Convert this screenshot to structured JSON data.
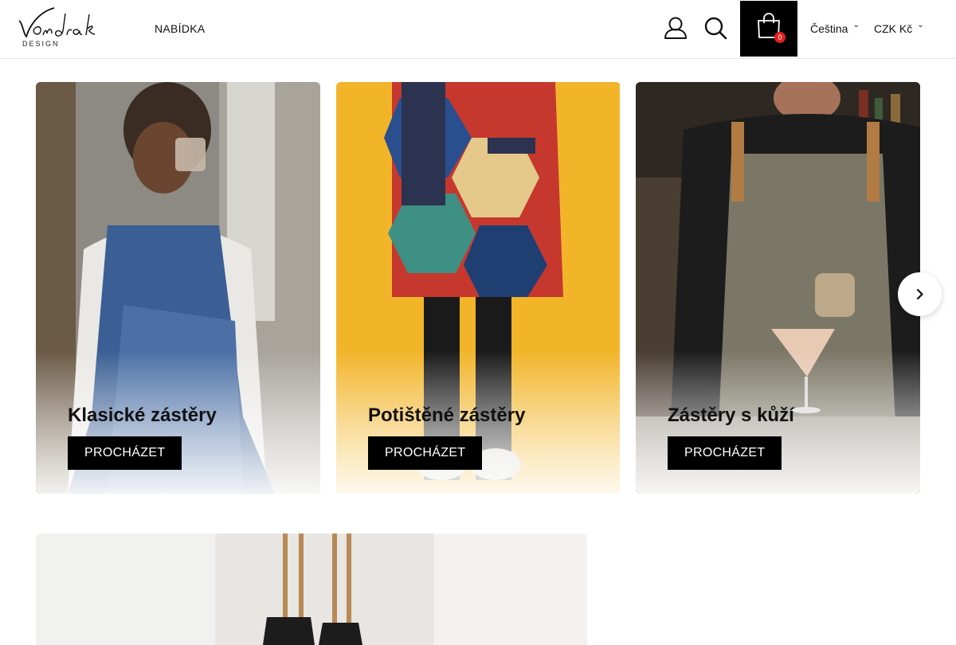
{
  "header": {
    "logo_text": "Vondrak",
    "logo_sub": "DESIGN",
    "nav_menu": "NABÍDKA",
    "cart_count": "0",
    "language": "Čeština",
    "currency": "CZK Kč"
  },
  "categories": [
    {
      "title": "Klasické zástěry",
      "button": "PROCHÁZET"
    },
    {
      "title": "Potištěné zástěry",
      "button": "PROCHÁZET"
    },
    {
      "title": "Zástěry s kůží",
      "button": "PROCHÁZET"
    }
  ],
  "colors": {
    "cart_bg": "#000000",
    "badge": "#e1201d",
    "card2_bg": "#f2b52a"
  },
  "icons": [
    "user-icon",
    "search-icon",
    "shopping-bag-icon",
    "chevron-down-icon",
    "chevron-right-icon"
  ]
}
